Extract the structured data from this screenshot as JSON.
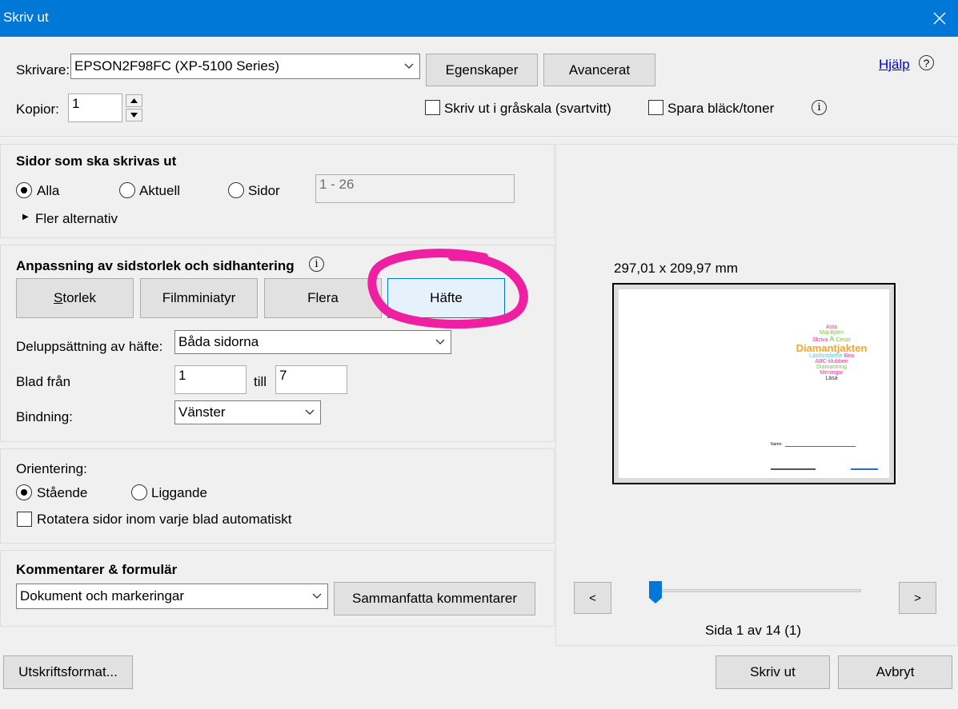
{
  "window": {
    "title": "Skriv ut"
  },
  "printer": {
    "label": "Skrivare:",
    "selected": "EPSON2F98FC (XP-5100 Series)",
    "properties_button": "Egenskaper",
    "advanced_button": "Avancerat",
    "help_link": "Hjälp",
    "copies_label": "Kopior:",
    "copies_value": "1",
    "grayscale_label": "Skriv ut i gråskala (svartvitt)",
    "grayscale_checked": false,
    "save_ink_label": "Spara bläck/toner",
    "save_ink_checked": false
  },
  "pages": {
    "heading": "Sidor som ska skrivas ut",
    "all_label": "Alla",
    "current_label": "Aktuell",
    "pages_label": "Sidor",
    "selected": "Alla",
    "range_value": "1 - 26",
    "more_options": "Fler alternativ"
  },
  "sizing": {
    "heading": "Anpassning av sidstorlek och sidhantering",
    "tabs": [
      {
        "label_before": "",
        "label_underlined": "S",
        "label_after": "torlek"
      },
      {
        "label_before": "Filmminiatyr",
        "label_underlined": "",
        "label_after": ""
      },
      {
        "label_before": "Flera",
        "label_underlined": "",
        "label_after": ""
      },
      {
        "label_before": "Häfte",
        "label_underlined": "",
        "label_after": ""
      }
    ],
    "active_tab": "Häfte",
    "booklet_subset_label": "Deluppsättning av häfte:",
    "booklet_subset_value": "Båda sidorna",
    "sheets_from_label": "Blad från",
    "sheets_from_value": "1",
    "to_label": "till",
    "sheets_to_value": "7",
    "binding_label": "Bindning:",
    "binding_value": "Vänster"
  },
  "orientation": {
    "heading": "Orientering:",
    "portrait_label": "Stående",
    "landscape_label": "Liggande",
    "selected": "Stående",
    "auto_rotate_label": "Rotatera sidor inom varje blad automatiskt",
    "auto_rotate_checked": false
  },
  "comments": {
    "heading": "Kommentarer & formulär",
    "selected": "Dokument och markeringar",
    "summarize_button": "Sammanfatta kommentarer"
  },
  "preview": {
    "size_text": "297,01 x 209,97 mm",
    "prev_button": "<",
    "next_button": ">",
    "page_indicator": "Sida 1 av 14 (1)",
    "current_page": 1,
    "total_pages": 14,
    "word_cloud": [
      {
        "text": "Asta",
        "color": "#e8378f"
      },
      {
        "text": "Maj-Björn",
        "color": "#7cc242"
      },
      {
        "text": "Skriva",
        "color": "#e8378f"
      },
      {
        "text": "Cesar",
        "color": "#7cc242"
      },
      {
        "text": "A",
        "color": "#7cc242"
      },
      {
        "text": "Diamantjakten",
        "color": "#f5a623"
      },
      {
        "text": "Läsförståelse",
        "color": "#4fc3e8"
      },
      {
        "text": "Bea",
        "color": "#e8378f"
      },
      {
        "text": "ABC-klubben",
        "color": "#e8378f"
      },
      {
        "text": "Diamantring",
        "color": "#7cc242"
      },
      {
        "text": "Meningar",
        "color": "#e8378f"
      },
      {
        "text": "Läsa",
        "color": "#333333"
      }
    ],
    "name_label": "Namn:"
  },
  "footer": {
    "print_format_button": "Utskriftsformat...",
    "print_button": "Skriv ut",
    "cancel_button": "Avbryt"
  },
  "colors": {
    "titlebar": "#0078d7",
    "highlight_marker": "#ee1fa0",
    "active_tab": "#e5f1fb"
  }
}
